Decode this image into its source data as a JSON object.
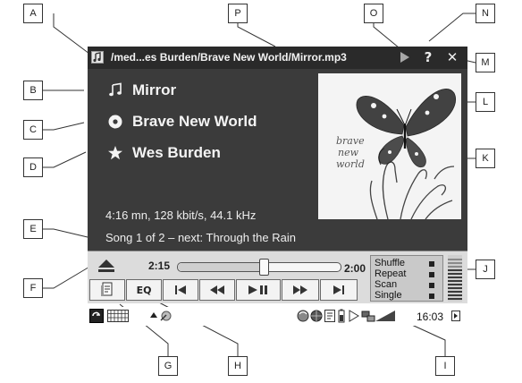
{
  "callouts": [
    "A",
    "B",
    "C",
    "D",
    "E",
    "F",
    "G",
    "H",
    "I",
    "J",
    "K",
    "L",
    "M",
    "N",
    "O",
    "P"
  ],
  "titlebar": {
    "path": "/med...es Burden/Brave New World/Mirror.mp3",
    "play_icon": "play-triangle-icon",
    "help_label": "?",
    "close_label": "✕"
  },
  "track": {
    "title": "Mirror",
    "album": "Brave New World",
    "artist": "Wes Burden",
    "format": "4:16 mn,  128 kbit/s,  44.1 kHz",
    "queue": "Song 1 of 2 – next: Through the Rain"
  },
  "cover_art": {
    "lines": [
      "brave",
      "new",
      "world"
    ]
  },
  "controls": {
    "elapsed": "2:15",
    "remaining": "2:00",
    "progress": 0.53,
    "eq_label": "EQ",
    "modes": [
      "Shuffle",
      "Repeat",
      "Scan",
      "Single"
    ]
  },
  "taskbar": {
    "clock": "16:03"
  },
  "colors": {
    "player_bg": "#3b3b3b",
    "titlebar_bg": "#2a2a2a",
    "controls_bg": "#dcdcdc"
  }
}
